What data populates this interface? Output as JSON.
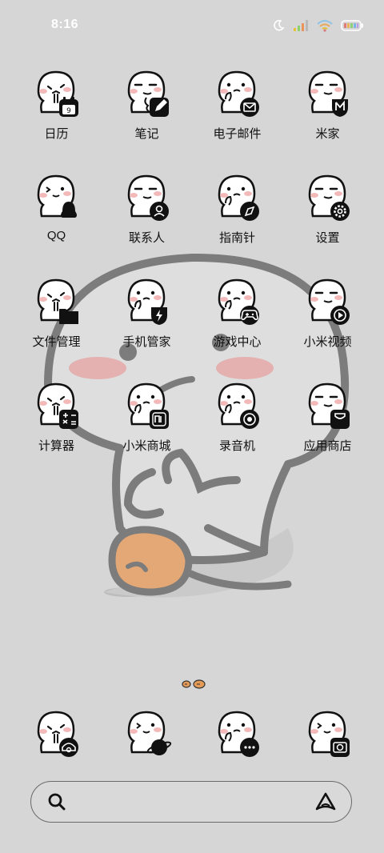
{
  "status_bar": {
    "time": "8:16"
  },
  "apps": [
    {
      "label": "日历",
      "badge": "calendar-icon",
      "face": "cry"
    },
    {
      "label": "笔记",
      "badge": "note-icon",
      "face": "sly"
    },
    {
      "label": "电子邮件",
      "badge": "mail-icon",
      "face": "think"
    },
    {
      "label": "米家",
      "badge": "mijia-icon",
      "face": "sly"
    },
    {
      "label": "QQ",
      "badge": "qq-penguin-icon",
      "face": "wink"
    },
    {
      "label": "联系人",
      "badge": "contacts-icon",
      "face": "sly"
    },
    {
      "label": "指南针",
      "badge": "compass-icon",
      "face": "think"
    },
    {
      "label": "设置",
      "badge": "gear-icon",
      "face": "sly"
    },
    {
      "label": "文件管理",
      "badge": "folder-icon",
      "face": "cry"
    },
    {
      "label": "手机管家",
      "badge": "shield-icon",
      "face": "think"
    },
    {
      "label": "游戏中心",
      "badge": "gamepad-icon",
      "face": "think"
    },
    {
      "label": "小米视频",
      "badge": "play-icon",
      "face": "sly"
    },
    {
      "label": "计算器",
      "badge": "calculator-icon",
      "face": "cry"
    },
    {
      "label": "小米商城",
      "badge": "mi-store-icon",
      "face": "think"
    },
    {
      "label": "录音机",
      "badge": "recorder-icon",
      "face": "think"
    },
    {
      "label": "应用商店",
      "badge": "shopping-bag-icon",
      "face": "sly"
    }
  ],
  "dock": [
    {
      "label": "",
      "badge": "telephone-icon",
      "face": "cry"
    },
    {
      "label": "",
      "badge": "planet-icon",
      "face": "wink"
    },
    {
      "label": "",
      "badge": "message-icon",
      "face": "think"
    },
    {
      "label": "",
      "badge": "camera-icon",
      "face": "wink"
    }
  ],
  "colors": {
    "background": "#d6d6d6",
    "wallpaper_line": "#7f7f7f",
    "blush": "#e8a8a8",
    "bun": "#e3a876"
  }
}
